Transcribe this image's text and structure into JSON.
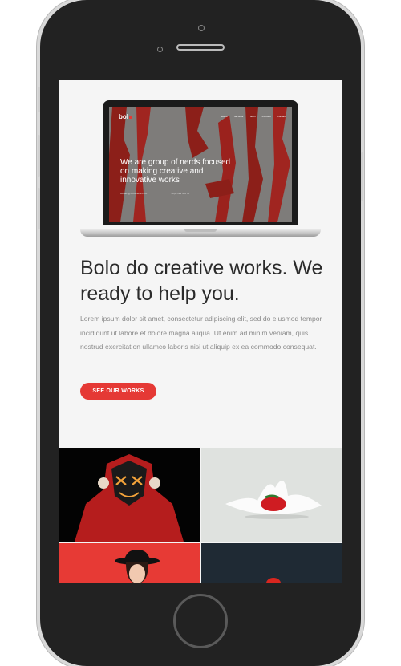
{
  "preview": {
    "logo": "bol",
    "nav": [
      "Home",
      "Services",
      "Team",
      "Portfolio",
      "Contact"
    ],
    "heading": "We are group of nerds focused on making creative and innovative works",
    "contact": [
      "contact@bolotheme.com",
      "+1(0) 123 456 78"
    ]
  },
  "content": {
    "headline": "Bolo do creative works. We ready to help you.",
    "body": "Lorem ipsum dolor sit amet, consectetur adipiscing elit, sed do eiusmod tempor incididunt ut labore et dolore magna aliqua. Ut enim ad minim veniam, quis nostrud exercitation ullamco laboris nisi ut aliquip ex ea commodo consequat.",
    "cta_label": "SEE OUR WORKS"
  },
  "gallery": {
    "items": [
      "masked-hoodie-figure",
      "strawberry-milk-splash",
      "woman-in-hat-on-red",
      "red-object-on-dark"
    ]
  },
  "colors": {
    "accent": "#e53935",
    "phone_body": "#222222",
    "screen_bg": "#f5f5f5"
  }
}
